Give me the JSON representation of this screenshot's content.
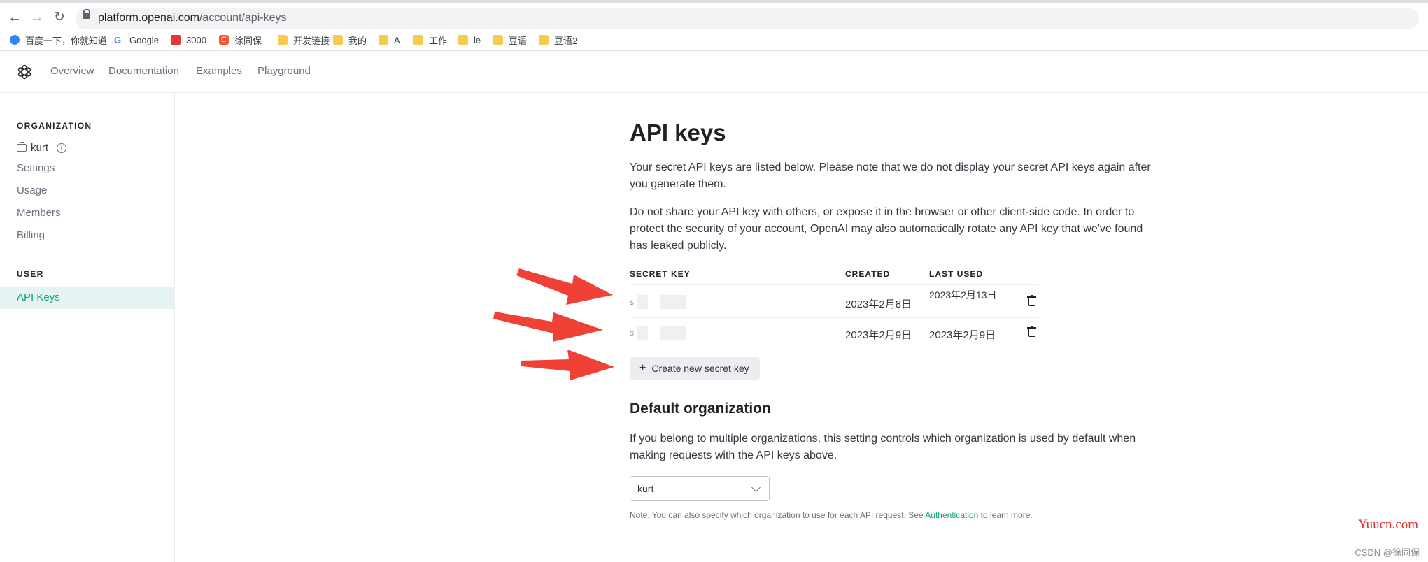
{
  "browser": {
    "url_host": "platform.openai.com",
    "url_path": "/account/api-keys",
    "bookmarks": [
      {
        "label": "百度一下，你就知道",
        "icon": "baidu-icon",
        "color": "#3385ff"
      },
      {
        "label": "Google",
        "icon": "google-icon",
        "color": "#4285f4"
      },
      {
        "label": "3000",
        "icon": "app-icon",
        "color": "#e53935"
      },
      {
        "label": "徐同保",
        "icon": "csdn-icon",
        "color": "#fc5531"
      },
      {
        "label": "开发链接",
        "icon": "folder-icon",
        "color": "#f7cb4d"
      },
      {
        "label": "我的",
        "icon": "folder-icon",
        "color": "#f7cb4d"
      },
      {
        "label": "A",
        "icon": "folder-icon",
        "color": "#f7cb4d"
      },
      {
        "label": "工作",
        "icon": "folder-icon",
        "color": "#f7cb4d"
      },
      {
        "label": "le",
        "icon": "folder-icon",
        "color": "#f7cb4d"
      },
      {
        "label": "豆语",
        "icon": "folder-icon",
        "color": "#f7cb4d"
      },
      {
        "label": "豆语2",
        "icon": "folder-icon",
        "color": "#f7cb4d"
      }
    ]
  },
  "header": {
    "nav": [
      "Overview",
      "Documentation",
      "Examples",
      "Playground"
    ]
  },
  "sidebar": {
    "org_heading": "ORGANIZATION",
    "org_name": "kurt",
    "org_items": [
      "Settings",
      "Usage",
      "Members",
      "Billing"
    ],
    "user_heading": "USER",
    "active_item": "API Keys"
  },
  "main": {
    "title": "API keys",
    "para1": "Your secret API keys are listed below. Please note that we do not display your secret API keys again after you generate them.",
    "para2": "Do not share your API key with others, or expose it in the browser or other client-side code. In order to protect the security of your account, OpenAI may also automatically rotate any API key that we've found has leaked publicly.",
    "table": {
      "headers": [
        "SECRET KEY",
        "CREATED",
        "LAST USED"
      ],
      "rows": [
        {
          "key": "s",
          "created": "2023年2月8日",
          "last_used": "2023年2月13日"
        },
        {
          "key": "s",
          "created": "2023年2月9日",
          "last_used": "2023年2月9日"
        }
      ]
    },
    "create_button": "Create new secret key",
    "default_org_title": "Default organization",
    "default_org_desc": "If you belong to multiple organizations, this setting controls which organization is used by default when making requests with the API keys above.",
    "org_select_value": "kurt",
    "note_pre": "Note: You can also specify which organization to use for each API request. See",
    "note_link": "Authentication",
    "note_post": "to learn more."
  },
  "colors": {
    "accent": "#10a37f",
    "arrow": "#ef4136"
  },
  "watermarks": {
    "site": "Yuucn.com",
    "author": "CSDN @徐同保"
  }
}
